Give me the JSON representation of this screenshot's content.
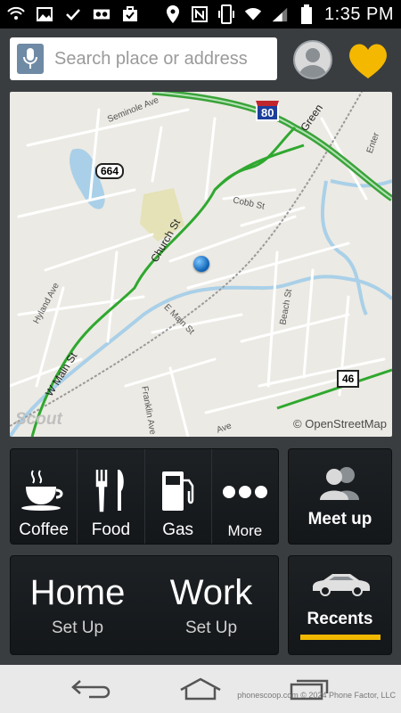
{
  "status_bar": {
    "time": "1:35 PM",
    "icons": [
      "wifi-hotspot-icon",
      "image-icon",
      "check-icon",
      "voicemail-icon",
      "briefcase-icon",
      "location-icon",
      "nfc-icon",
      "vibrate-icon",
      "wifi-icon",
      "signal-icon",
      "battery-icon"
    ]
  },
  "search": {
    "placeholder": "Search place or address",
    "icon": "mic-icon"
  },
  "header_icons": [
    "profile-avatar-icon",
    "heart-favorites-icon"
  ],
  "map": {
    "labels": {
      "seminole": "Seminole Ave",
      "route664": "664",
      "route80": "80",
      "route46": "46",
      "church": "Church St",
      "cobb": "Cobb St",
      "emain": "E Main St",
      "wmain": "W Main St",
      "hyland": "Hyland Ave",
      "beach": "Beach St",
      "franklin": "Franklin Ave",
      "green": "Green",
      "enter": "Enter",
      "ave": "Ave"
    },
    "logo": "Scout",
    "attribution": "© OpenStreetMap"
  },
  "categories": [
    {
      "label": "Coffee",
      "icon": "coffee-cup-icon"
    },
    {
      "label": "Food",
      "icon": "fork-knife-icon"
    },
    {
      "label": "Gas",
      "icon": "gas-pump-icon"
    },
    {
      "label": "More",
      "icon": "more-dots-icon"
    }
  ],
  "meetup": {
    "label": "Meet up",
    "icon": "people-icon"
  },
  "places": [
    {
      "title": "Home",
      "subtitle": "Set Up"
    },
    {
      "title": "Work",
      "subtitle": "Set Up"
    }
  ],
  "recents": {
    "label": "Recents",
    "icon": "car-icon"
  },
  "nav": [
    "back-icon",
    "home-icon",
    "recent-apps-icon"
  ],
  "watermark": "phonescoop.com  © 2024 Phone Factor, LLC",
  "colors": {
    "accent": "#f0b800",
    "heart": "#f5b800",
    "route_green": "#2fa82f"
  }
}
